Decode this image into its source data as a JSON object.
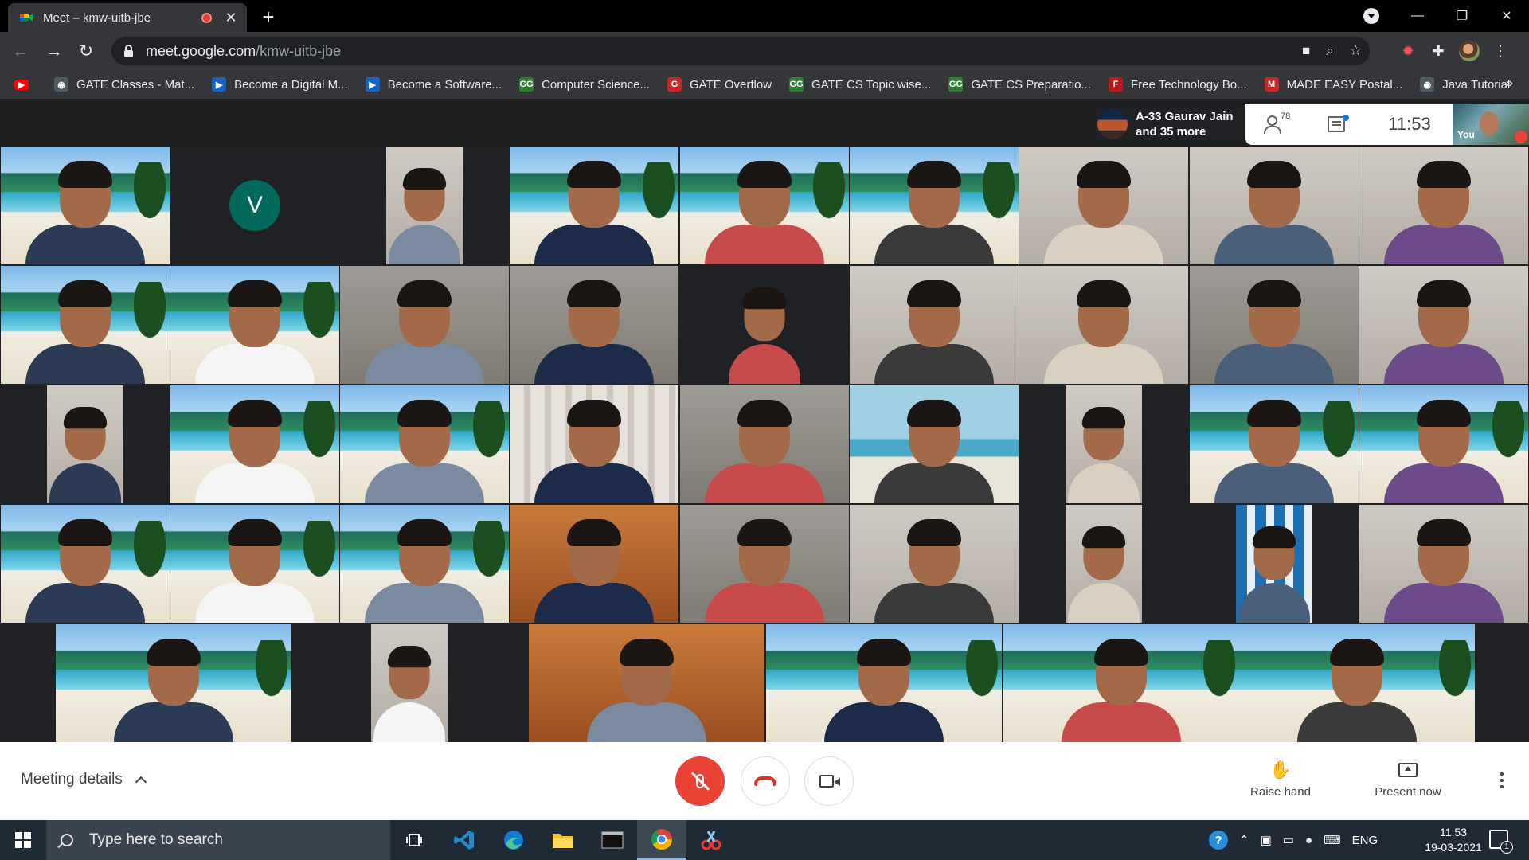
{
  "browser": {
    "tab_title": "Meet – kmw-uitb-jbe",
    "tab_close": "✕",
    "new_tab": "+",
    "url_host": "meet.google.com",
    "url_path": "/kmw-uitb-jbe",
    "back": "←",
    "forward": "→",
    "reload": "↻",
    "minimize": "—",
    "restore": "❐",
    "close": "✕"
  },
  "bookmarks": [
    {
      "label": "GATE Classes - Mat...",
      "icon": "chrome-icon",
      "color": "#4f5b62",
      "glyph": "◉"
    },
    {
      "label": "Become a Digital M...",
      "icon": "site-icon",
      "color": "#1565c0",
      "glyph": "▶"
    },
    {
      "label": "Become a Software...",
      "icon": "site-icon",
      "color": "#1565c0",
      "glyph": "▶"
    },
    {
      "label": "Computer Science...",
      "icon": "gfg-icon",
      "color": "#2e7d32",
      "glyph": "GG"
    },
    {
      "label": "GATE Overflow",
      "icon": "gate-overflow-icon",
      "color": "#c62828",
      "glyph": "G"
    },
    {
      "label": "GATE CS Topic wise...",
      "icon": "gfg-icon",
      "color": "#2e7d32",
      "glyph": "GG"
    },
    {
      "label": "GATE CS Preparatio...",
      "icon": "gfg-icon",
      "color": "#2e7d32",
      "glyph": "GG"
    },
    {
      "label": "Free Technology Bo...",
      "icon": "site-icon",
      "color": "#b71c1c",
      "glyph": "F"
    },
    {
      "label": "MADE EASY Postal...",
      "icon": "made-easy-icon",
      "color": "#c62828",
      "glyph": "M"
    },
    {
      "label": "Java Tutorial",
      "icon": "chrome-icon",
      "color": "#4f5b62",
      "glyph": "◉"
    }
  ],
  "bookmarks_more": "»",
  "meet": {
    "presenter_line1": "A-33 Gaurav Jain",
    "presenter_line2": "and 35 more",
    "participants_count": "78",
    "clock": "11:53",
    "self_label": "You",
    "avatar_letter": "V",
    "meeting_details": "Meeting details",
    "raise_hand": "Raise hand",
    "present_now": "Present now"
  },
  "taskbar": {
    "search_placeholder": "Type here to search",
    "language": "ENG",
    "time": "11:53",
    "date": "19-03-2021",
    "notification_count": "1"
  }
}
